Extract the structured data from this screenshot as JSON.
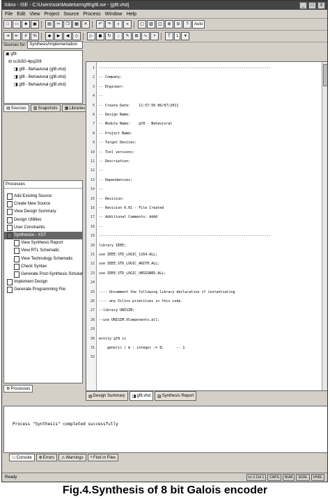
{
  "window": {
    "title": "Xilinx - ISE - C:\\Users\\ssk\\Modelsim\\gf8\\gf8.ise - [gf8.vhd]",
    "buttons": [
      "_",
      "□",
      "X"
    ]
  },
  "menubar": [
    "File",
    "Edit",
    "View",
    "Project",
    "Source",
    "Process",
    "Window",
    "Help"
  ],
  "toolbar1": {
    "select_value": "Auto"
  },
  "toolbar2": {
    "select_value": "1"
  },
  "sources": {
    "label": "Sources for:",
    "dropdown": "Synthesis/Implementation",
    "tree": [
      "gf8",
      "xc3s50-4pq208",
      "gf8 - Behavioral (gf8.vhd)",
      "gf8 - Behavioral (gf8.vhd)",
      "gf8 - Behavioral (gf8.vhd)"
    ],
    "tabs": [
      "Sources",
      "Snapshots",
      "Libraries"
    ]
  },
  "processes": {
    "title": "Processes",
    "items": [
      "Add Existing Source",
      "Create New Source",
      "View Design Summary",
      "Design Utilities",
      "User Constraints",
      "Synthesize - XST",
      "View Synthesis Report",
      "View RTL Schematic",
      "View Technology Schematic",
      "Check Syntax",
      "Generate Post-Synthesis Simulation Model",
      "Implement Design",
      "Generate Programming File"
    ],
    "highlighted_index": 5,
    "tab": "Processes"
  },
  "editor": {
    "lines": [
      "----------------------------------------------------------------------------------",
      "-- Company:",
      "-- Engineer:",
      "--",
      "-- Create Date:    11:57:50 06/07/2011",
      "-- Design Name:",
      "-- Module Name:    gf8 - Behavioral",
      "-- Project Name:",
      "-- Target Devices:",
      "-- Tool versions:",
      "-- Description:",
      "--",
      "-- Dependencies:",
      "--",
      "-- Revision:",
      "-- Revision 0.01 - File Created",
      "-- Additional Comments: dddd",
      "--",
      "----------------------------------------------------------------------------------",
      "library IEEE;",
      "use IEEE.STD_LOGIC_1164.ALL;",
      "use IEEE.STD_LOGIC_ARITH.ALL;",
      "use IEEE.STD_LOGIC_UNSIGNED.ALL;",
      "",
      "---- Uncomment the following library declaration if instantiating",
      "---- any Xilinx primitives in this code.",
      "--library UNISIM;",
      "--use UNISIM.VComponents.all;",
      "",
      "entity gf8 is",
      "    generic ( m : integer := 8;      -- 1",
      "      "
    ],
    "tabs": [
      "Design Summary",
      "gf8.vhd",
      "Synthesis Report"
    ]
  },
  "console": {
    "message": "Process \"Synthesis\" completed successfully",
    "tabs": [
      "Console",
      "Errors",
      "Warnings",
      "Find in Files"
    ]
  },
  "status": {
    "text": "Ready",
    "boxes": [
      "Ln 1 Col 1",
      "CAPS",
      "NUM",
      "SCRL",
      "VHDL"
    ]
  },
  "caption": "Fig.4.Synthesis of 8 bit Galois encoder"
}
